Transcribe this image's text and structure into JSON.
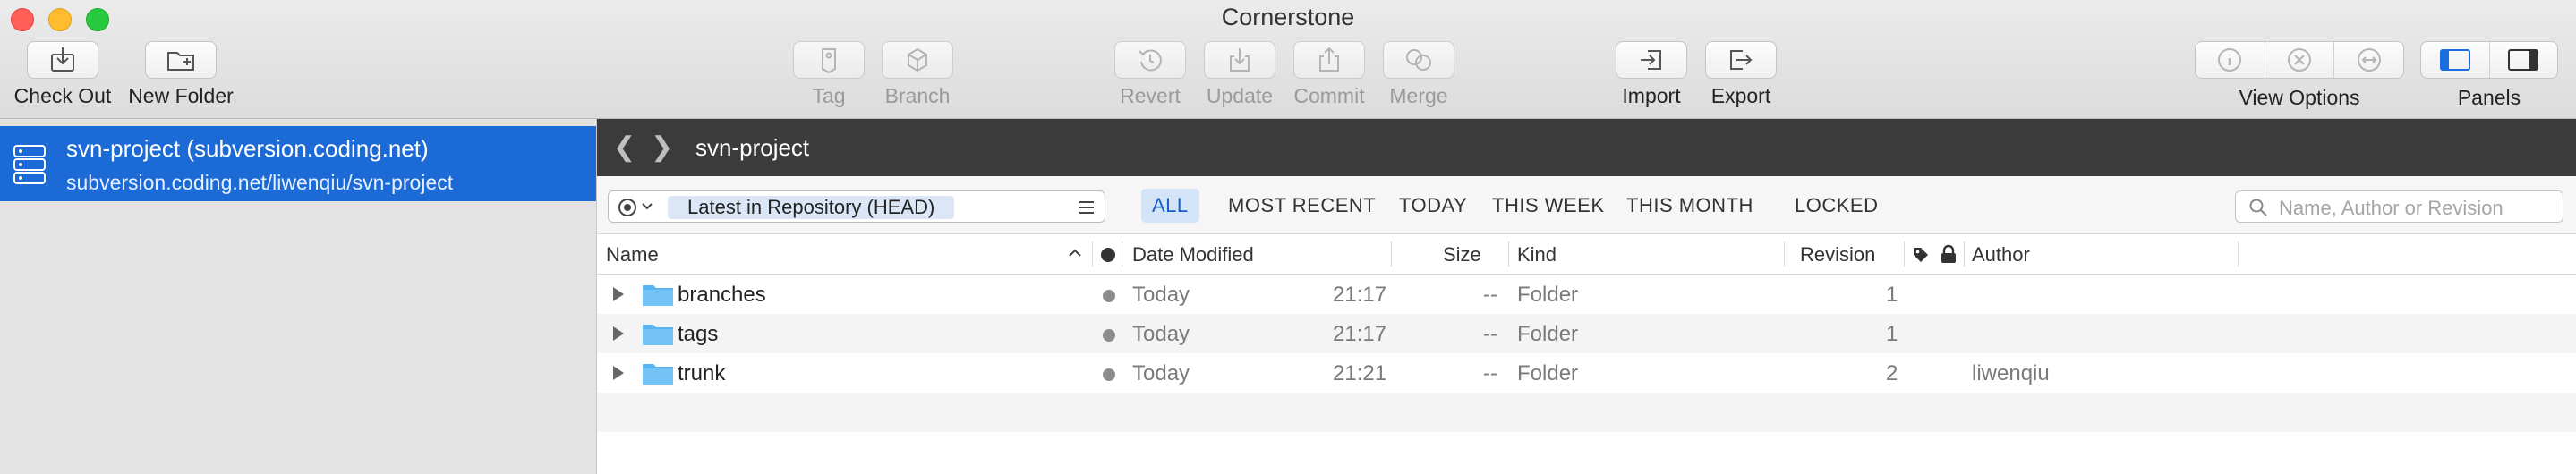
{
  "window": {
    "title": "Cornerstone"
  },
  "toolbar": {
    "check_out": "Check Out",
    "new_folder": "New Folder",
    "tag": "Tag",
    "branch": "Branch",
    "revert": "Revert",
    "update": "Update",
    "commit": "Commit",
    "merge": "Merge",
    "import": "Import",
    "export": "Export",
    "view_options": "View Options",
    "panels": "Panels"
  },
  "sidebar": {
    "repo": {
      "name": "svn-project (subversion.coding.net)",
      "url": "subversion.coding.net/liwenqiu/svn-project"
    }
  },
  "pathbar": {
    "title": "svn-project"
  },
  "filterbar": {
    "revision": "Latest in Repository (HEAD)",
    "filters": [
      "ALL",
      "MOST RECENT",
      "TODAY",
      "THIS WEEK",
      "THIS MONTH",
      "LOCKED"
    ],
    "active_filter": "ALL",
    "search_placeholder": "Name, Author or Revision"
  },
  "table": {
    "headers": {
      "name": "Name",
      "date_modified": "Date Modified",
      "size": "Size",
      "kind": "Kind",
      "revision": "Revision",
      "author": "Author"
    },
    "rows": [
      {
        "name": "branches",
        "date": "Today",
        "time": "21:17",
        "size": "--",
        "kind": "Folder",
        "revision": "1",
        "author": ""
      },
      {
        "name": "tags",
        "date": "Today",
        "time": "21:17",
        "size": "--",
        "kind": "Folder",
        "revision": "1",
        "author": ""
      },
      {
        "name": "trunk",
        "date": "Today",
        "time": "21:21",
        "size": "--",
        "kind": "Folder",
        "revision": "2",
        "author": "liwenqiu"
      }
    ]
  },
  "colors": {
    "selection": "#1b6ad6",
    "pathbar": "#3b3b3b",
    "active_filter": "#1a5fc9",
    "folder": "#5ab4f0"
  }
}
